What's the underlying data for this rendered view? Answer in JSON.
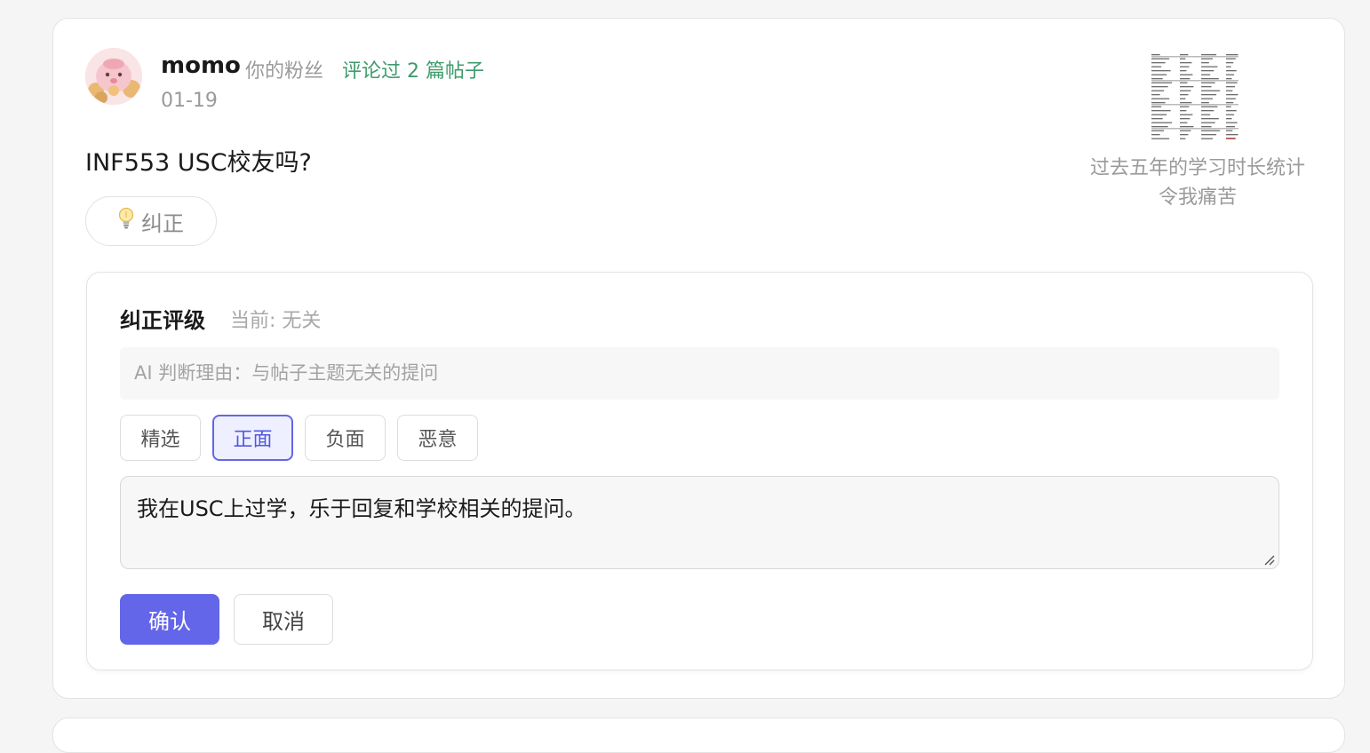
{
  "post": {
    "username": "momo",
    "fan_label": "你的粉丝",
    "comment_count_label": "评论过 2 篇帖子",
    "date": "01-19",
    "content": "INF553 USC校友吗?",
    "correct_button_label": "纠正",
    "correct_button_icon": "lightbulb-icon",
    "thumbnail_caption": "过去五年的学习时长统计令我痛苦"
  },
  "panel": {
    "title": "纠正评级",
    "current_label": "当前: 无关",
    "ai_reason": "AI 判断理由：与帖子主题无关的提问",
    "ratings": [
      {
        "label": "精选"
      },
      {
        "label": "正面"
      },
      {
        "label": "负面"
      },
      {
        "label": "恶意"
      }
    ],
    "selected_rating": "正面",
    "reason_value": "我在USC上过学，乐于回复和学校相关的提问。",
    "confirm_label": "确认",
    "cancel_label": "取消"
  },
  "colors": {
    "accent": "#6366e8",
    "accent_light": "#eef0ff",
    "green_link": "#3e9b6a",
    "muted_text": "#9a9a9a"
  }
}
